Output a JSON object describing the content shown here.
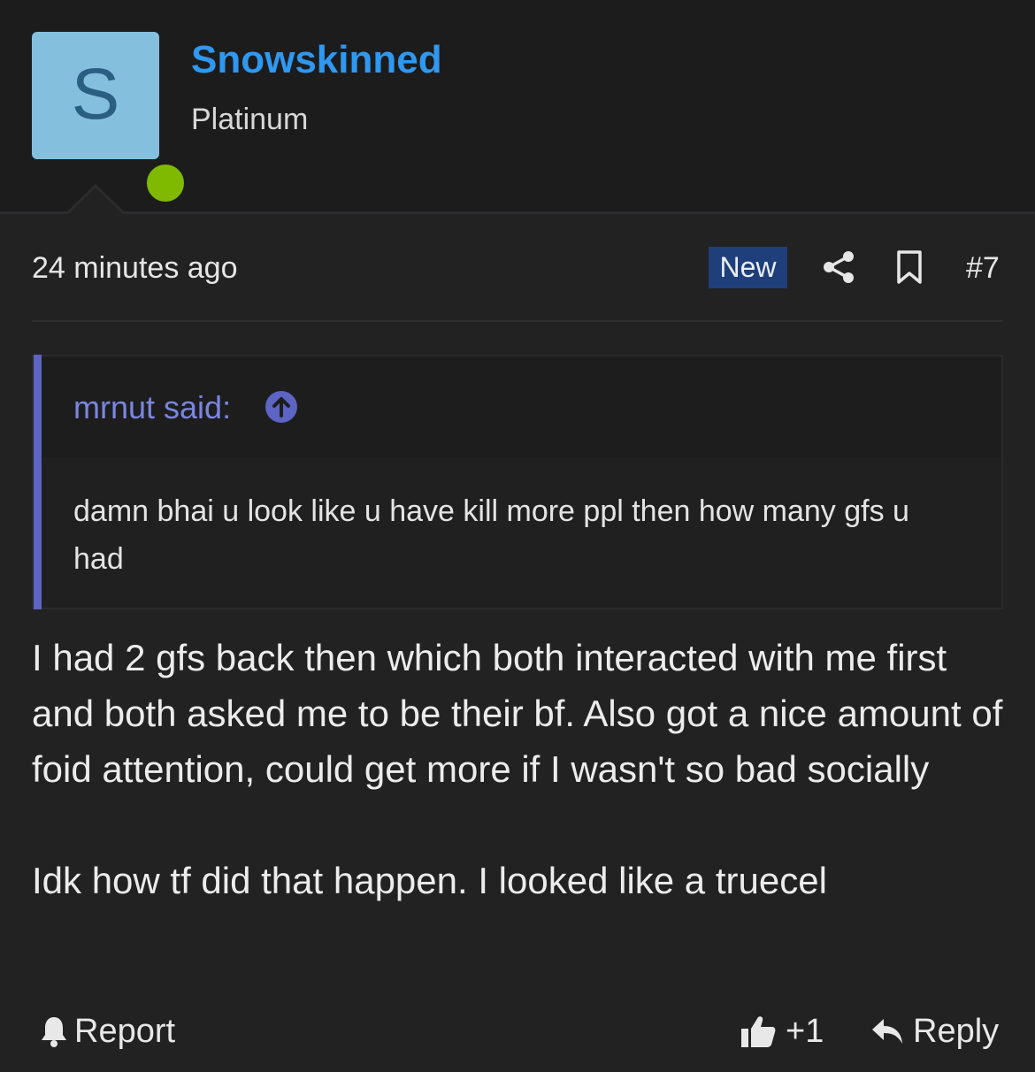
{
  "user": {
    "avatar_letter": "S",
    "name": "Snowskinned",
    "title": "Platinum"
  },
  "post": {
    "timestamp": "24 minutes ago",
    "badge": "New",
    "number": "#7",
    "quote": {
      "author": "mrnut said:",
      "text": "damn bhai u look like u have kill more ppl then how many gfs u had"
    },
    "message": [
      "I had 2 gfs back then which both interacted with me first and both asked me to be their bf. Also got a nice amount of foid attention, could get more if I wasn't so bad socially",
      "Idk how tf did that happen. I looked like a truecel"
    ]
  },
  "actions": {
    "report": "Report",
    "like_count": "+1",
    "reply": "Reply"
  },
  "colors": {
    "username": "#2f98f0",
    "quote_bar": "#5c64c4",
    "online": "#7fba00",
    "badge_bg": "#1f3f7a"
  },
  "icons": [
    "share-icon",
    "bookmark-icon",
    "arrow-up-circle-icon",
    "bell-icon",
    "thumbs-up-icon",
    "reply-icon"
  ]
}
